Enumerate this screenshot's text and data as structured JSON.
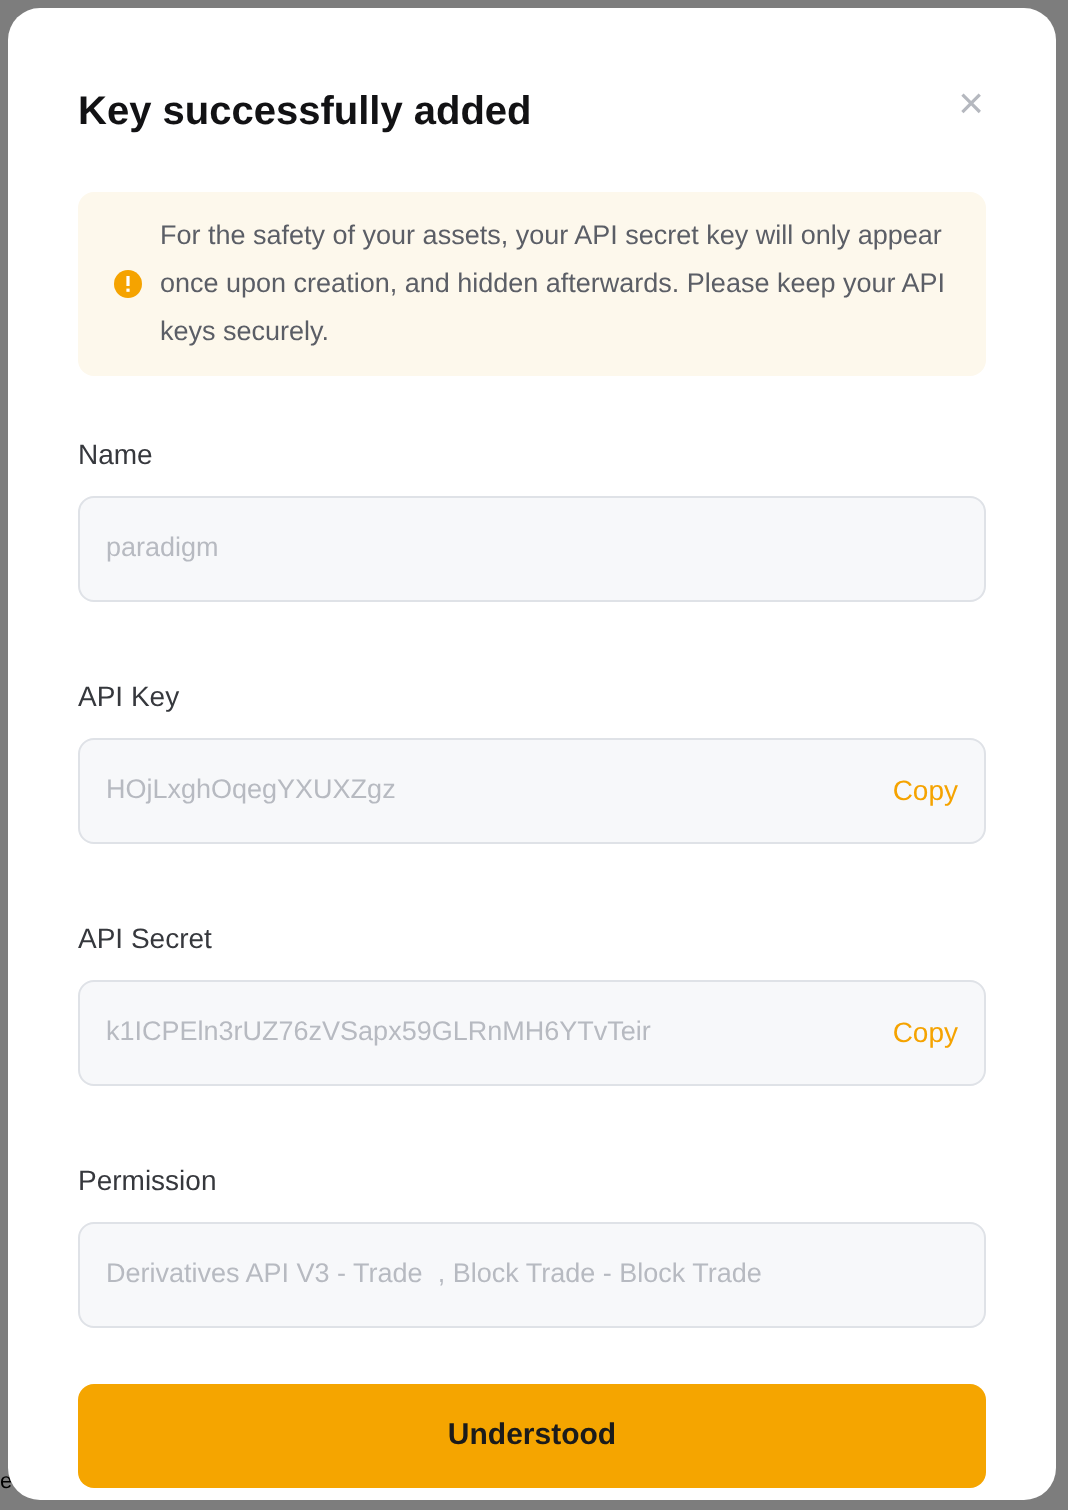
{
  "background_text": "e",
  "dialog": {
    "title": "Key successfully added",
    "close": "×",
    "notice": "For the safety of your assets, your API secret key will only appear once upon creation, and hidden afterwards. Please keep your API keys securely.",
    "fields": [
      {
        "label": "Name",
        "value": "paradigm"
      },
      {
        "label": "API Key",
        "value": "HOjLxghOqegYXUXZgz",
        "action": "Copy"
      },
      {
        "label": "API Secret",
        "value": "k1ICPEln3rUZ76zVSapx59GLRnMH6YTvTeir",
        "action": "Copy"
      },
      {
        "label": "Permission",
        "value": "Derivatives API V3 - Trade  , Block Trade - Block Trade"
      }
    ],
    "button": "Understood"
  }
}
